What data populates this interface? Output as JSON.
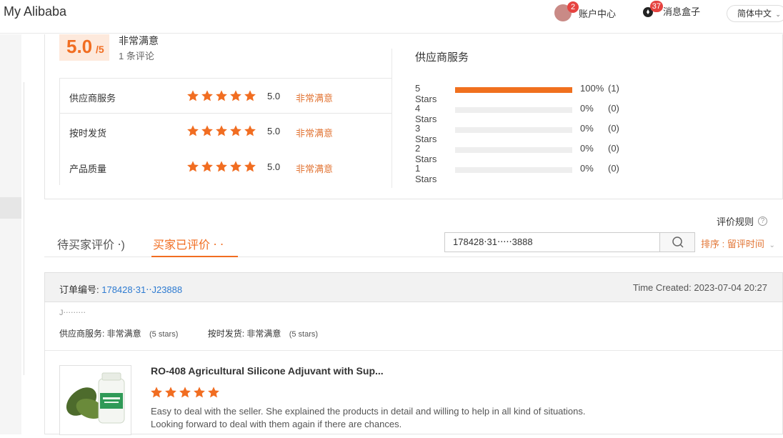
{
  "header": {
    "brand": "My Alibaba",
    "account_label": "账户中心",
    "account_badge": "2",
    "messages_label": "消息盒子",
    "messages_badge": "37",
    "language": "简体中文"
  },
  "summary": {
    "overall_score": "5.0",
    "overall_max": "/5",
    "overall_text": "非常满意",
    "review_count": "1 条评论",
    "rows": [
      {
        "label": "供应商服务",
        "value": "5.0",
        "tag": "非常满意",
        "stars": 5
      },
      {
        "label": "按时发货",
        "value": "5.0",
        "tag": "非常满意",
        "stars": 5
      },
      {
        "label": "产品质量",
        "value": "5.0",
        "tag": "非常满意",
        "stars": 5
      }
    ],
    "distribution_title": "供应商服务",
    "distribution": [
      {
        "label": "5  Stars",
        "pct": "100%",
        "count": "(1)",
        "fraction": 1.0
      },
      {
        "label": "4  Stars",
        "pct": "0%",
        "count": "(0)",
        "fraction": 0
      },
      {
        "label": "3  Stars",
        "pct": "0%",
        "count": "(0)",
        "fraction": 0
      },
      {
        "label": "2  Stars",
        "pct": "0%",
        "count": "(0)",
        "fraction": 0
      },
      {
        "label": "1  Stars",
        "pct": "0%",
        "count": "(0)",
        "fraction": 0
      }
    ]
  },
  "rules_label": "评价规则",
  "tabs": [
    {
      "label": "待买家评价 ‧)",
      "active": false
    },
    {
      "label": "买家已评价 ‧ ‧",
      "active": true
    }
  ],
  "search": {
    "value": "178428‧31‧‧‧‧‧3888"
  },
  "sort_label": "排序 : 留评时间",
  "colors": {
    "accent": "#f16d21",
    "link": "#2e7bd1"
  },
  "order": {
    "number_label": "订单编号: ",
    "number": "178428‧31‧‧J23888",
    "time_created": "Time Created: 2023-07-04 20:27",
    "buyer": "J‧‧‧‧‧‧‧‧‧",
    "service_label": "供应商服务: 非常满意",
    "service_stars": "(5 stars)",
    "shipping_label": "按时发货: 非常满意",
    "shipping_stars": "(5 stars)",
    "product_title": "RO-408 Agricultural Silicone Adjuvant with Sup...",
    "product_stars": 5,
    "review_line1": "Easy to deal with the seller. She explained the products in detail and willing to help in all kind of situations.",
    "review_line2": "Looking forward to deal with them again if there are chances."
  }
}
